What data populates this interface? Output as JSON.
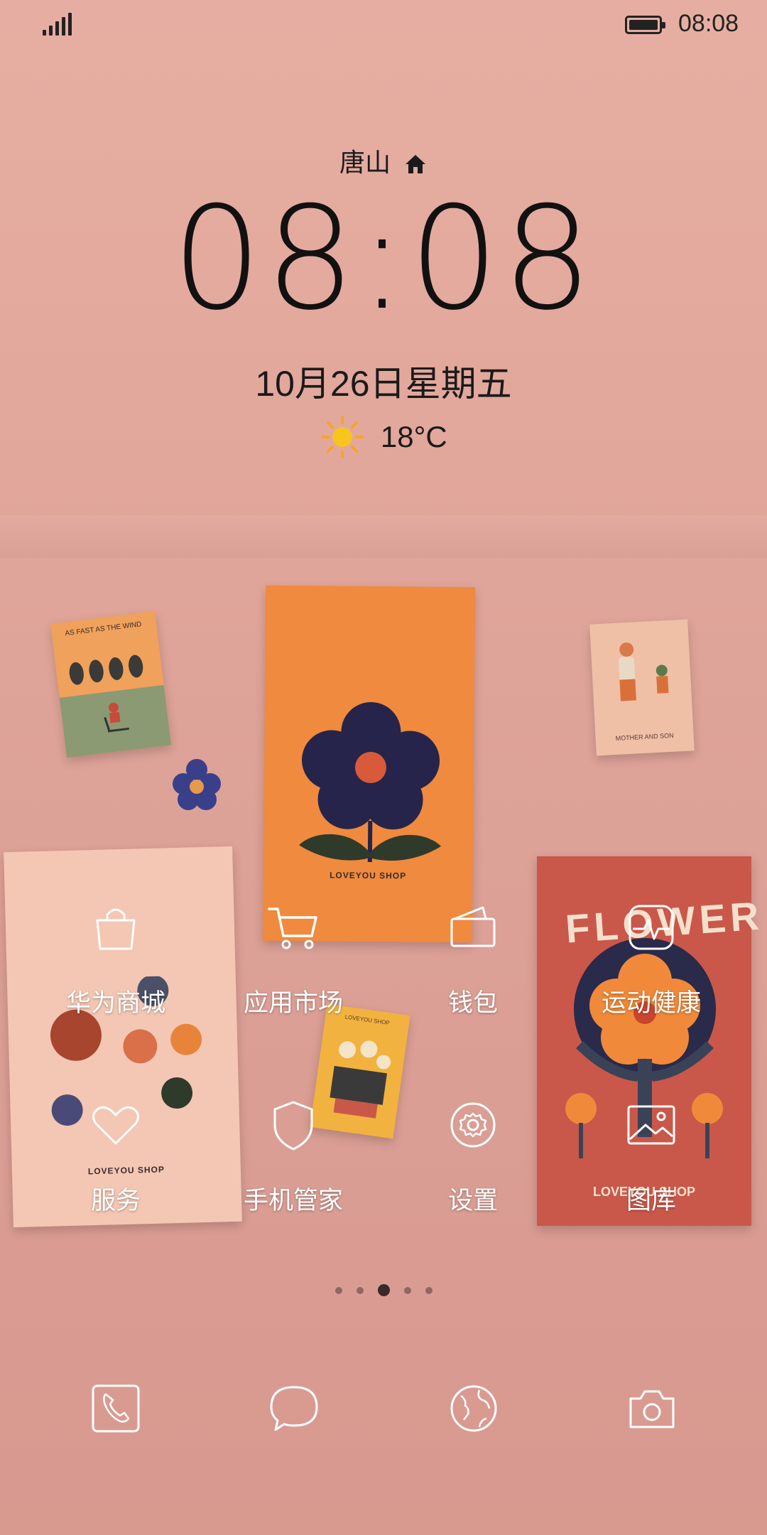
{
  "statusbar": {
    "signal_icon": "signal-strength-icon",
    "battery_icon": "battery-full-icon",
    "time": "08:08"
  },
  "clock_widget": {
    "city": "唐山",
    "home_icon": "home-icon",
    "time": "08:08",
    "date": "10月26日星期五",
    "weather_icon": "sunny-icon",
    "temperature": "18°C"
  },
  "apps": [
    {
      "label": "华为商城",
      "icon": "shopping-bag-icon"
    },
    {
      "label": "应用市场",
      "icon": "shopping-cart-icon"
    },
    {
      "label": "钱包",
      "icon": "wallet-icon"
    },
    {
      "label": "运动健康",
      "icon": "health-heartbeat-icon"
    },
    {
      "label": "服务",
      "icon": "heart-icon"
    },
    {
      "label": "手机管家",
      "icon": "shield-icon"
    },
    {
      "label": "设置",
      "icon": "gear-icon"
    },
    {
      "label": "图库",
      "icon": "gallery-image-icon"
    }
  ],
  "page_indicator": {
    "total": 5,
    "active": 3
  },
  "dock": [
    {
      "icon": "phone-icon"
    },
    {
      "icon": "message-bubble-icon"
    },
    {
      "icon": "browser-globe-icon"
    },
    {
      "icon": "camera-icon"
    }
  ],
  "wallpaper_text": {
    "orange_card": "LOVEYOU SHOP",
    "cream_card": "LOVEYOU SHOP",
    "red_card_title": "FLOWER",
    "red_card_footer": "LOVEYOU SHOP",
    "small_left_card": "AS FAST AS THE WIND",
    "small_right_card": "MOTHER AND SON",
    "yellow_card": "LOVEYOU SHOP"
  },
  "colors": {
    "background": "#e2a79b",
    "clock_text": "#111111",
    "app_label": "#ffffff"
  }
}
